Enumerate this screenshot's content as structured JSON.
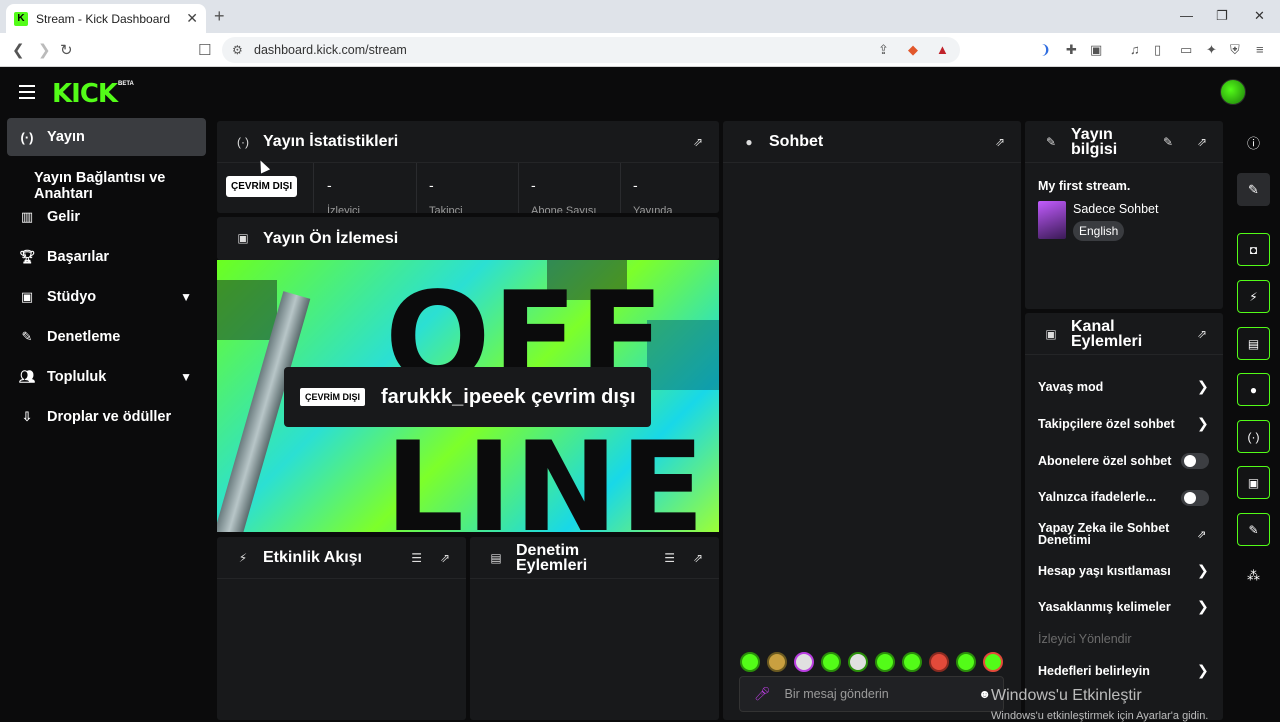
{
  "browser": {
    "tab_title": "Stream - Kick Dashboard",
    "favicon_letter": "K",
    "url": "dashboard.kick.com/stream"
  },
  "app": {
    "logo": "KICK",
    "logo_badge": "BETA"
  },
  "sidebar": {
    "items": [
      {
        "label": "Yayın",
        "icon": "broadcast-icon"
      },
      {
        "label": "Yayın Bağlantısı ve Anahtarı"
      },
      {
        "label": "Gelir",
        "icon": "chart-icon"
      },
      {
        "label": "Başarılar",
        "icon": "trophy-icon"
      },
      {
        "label": "Stüdyo",
        "icon": "studio-icon"
      },
      {
        "label": "Denetleme",
        "icon": "wrench-icon"
      },
      {
        "label": "Topluluk",
        "icon": "community-icon"
      },
      {
        "label": "Droplar ve ödüller",
        "icon": "drops-icon"
      }
    ]
  },
  "stats": {
    "title": "Yayın İstatistikleri",
    "status_badge": "ÇEVRİM DIŞI",
    "cells": [
      {
        "value": "-",
        "label": "İzleyici"
      },
      {
        "value": "-",
        "label": "Takipçi"
      },
      {
        "value": "-",
        "label": "Abone Sayısı"
      },
      {
        "value": "-",
        "label": "Yayında"
      }
    ]
  },
  "preview": {
    "title": "Yayın Ön İzlemesi",
    "offline_badge": "ÇEVRİM DIŞI",
    "offline_text": "farukkk_ipeeek çevrim dışı",
    "art_text_1": "OFF",
    "art_text_2": "LINE"
  },
  "activity": {
    "title": "Etkinlik Akışı"
  },
  "moderation": {
    "title": "Denetim Eylemleri"
  },
  "chat": {
    "title": "Sohbet",
    "placeholder": "Bir mesaj gönderin"
  },
  "stream_info": {
    "title": "Yayın bilgisi",
    "stream_title": "My first stream.",
    "category": "Sadece Sohbet",
    "language": "English"
  },
  "channel_actions": {
    "title": "Kanal Eylemleri",
    "items": [
      {
        "label": "Yavaş mod",
        "control": "chevron"
      },
      {
        "label": "Takipçilere özel sohbet",
        "control": "chevron"
      },
      {
        "label": "Abonelere özel sohbet",
        "control": "toggle",
        "on": false
      },
      {
        "label": "Yalnızca ifadelerle...",
        "control": "toggle",
        "on": false
      },
      {
        "label": "Yapay Zeka ile Sohbet Denetimi",
        "control": "external"
      },
      {
        "label": "Hesap yaşı kısıtlaması",
        "control": "chevron"
      },
      {
        "label": "Yasaklanmış kelimeler",
        "control": "chevron"
      },
      {
        "label": "İzleyici Yönlendir",
        "control": "none",
        "disabled": true
      },
      {
        "label": "Hedefleri belirleyin",
        "control": "chevron"
      }
    ]
  },
  "watermark": {
    "line1": "Windows'u Etkinleştir",
    "line2": "Windows'u etkinleştirmek için Ayarlar'a gidin."
  },
  "colors": {
    "accent": "#53fc18",
    "panel": "#18191b",
    "background": "#0b0b0c"
  }
}
